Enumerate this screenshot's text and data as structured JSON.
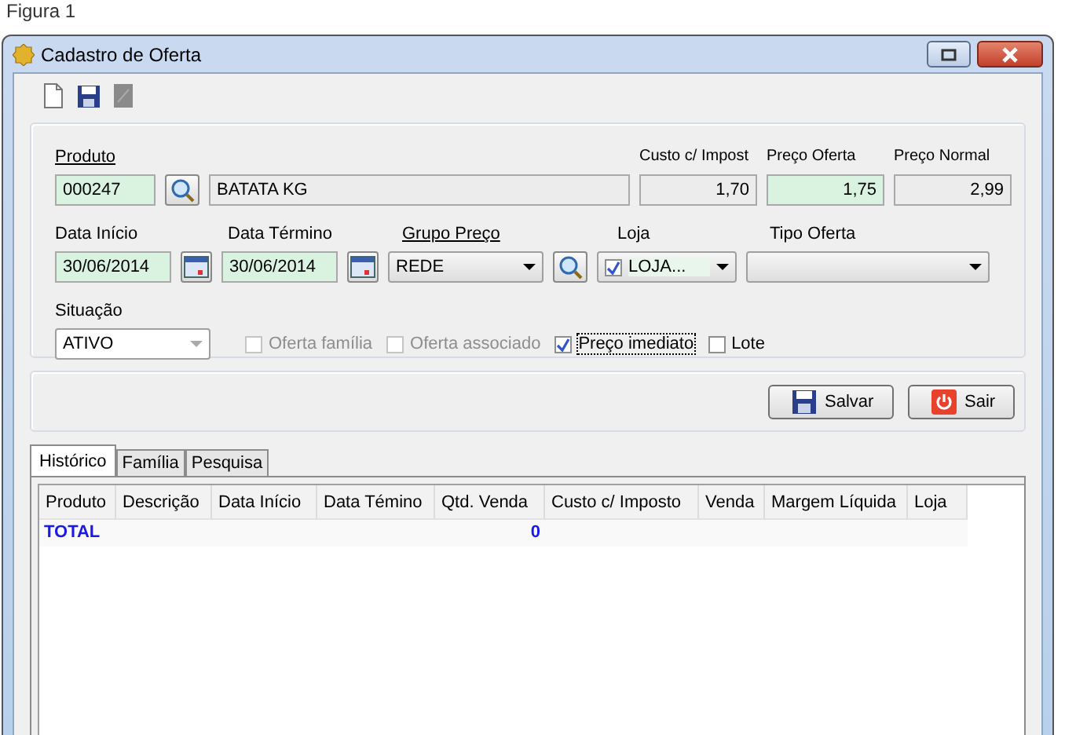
{
  "caption": "Figura 1",
  "window": {
    "title": "Cadastro de Oferta"
  },
  "form": {
    "produto": {
      "label": "Produto",
      "code": "000247",
      "description": "BATATA KG"
    },
    "prices": [
      {
        "label": "Custo c/ Impost",
        "value": "1,70",
        "highlight": false
      },
      {
        "label": "Preço Oferta",
        "value": "1,75",
        "highlight": true
      },
      {
        "label": "Preço Normal",
        "value": "2,99",
        "highlight": false
      }
    ],
    "data_inicio": {
      "label": "Data Início",
      "value": "30/06/2014"
    },
    "data_termino": {
      "label": "Data Término",
      "value": "30/06/2014"
    },
    "grupo_preco": {
      "label": "Grupo Preço",
      "value": "REDE"
    },
    "loja": {
      "label": "Loja",
      "value": "LOJA...",
      "checked": true
    },
    "tipo_oferta": {
      "label": "Tipo Oferta"
    },
    "situacao": {
      "label": "Situação",
      "value": "ATIVO",
      "disabled": true
    },
    "options": [
      {
        "label": "Oferta família",
        "checked": false,
        "disabled": true,
        "focused": false
      },
      {
        "label": "Oferta associado",
        "checked": false,
        "disabled": true,
        "focused": false
      },
      {
        "label": "Preço imediato",
        "checked": true,
        "disabled": false,
        "focused": true
      },
      {
        "label": "Lote",
        "checked": false,
        "disabled": false,
        "focused": false
      }
    ]
  },
  "buttons": [
    {
      "kind": "save",
      "label": "Salvar"
    },
    {
      "kind": "exit",
      "label": "Sair"
    }
  ],
  "tabs": [
    {
      "label": "Histórico",
      "selected": true
    },
    {
      "label": "Família",
      "selected": false
    },
    {
      "label": "Pesquisa",
      "selected": false
    }
  ],
  "table": {
    "columns": [
      "Produto",
      "Descrição",
      "Data Início",
      "Data Témino",
      "Qtd. Venda",
      "Custo c/ Imposto",
      "Venda",
      "Margem Líquida",
      "Loja"
    ],
    "total_row": {
      "label": "TOTAL",
      "qtd_venda": "0"
    }
  }
}
